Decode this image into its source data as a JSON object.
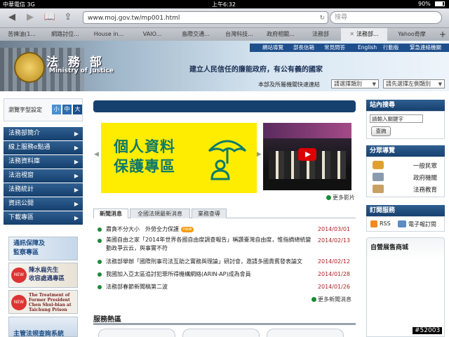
{
  "status": {
    "carrier": "中華電信 3G",
    "time": "上午6:32",
    "battery": "90%"
  },
  "browser": {
    "url": "www.moj.gov.tw/mp001.html",
    "search_placeholder": "搜尋",
    "tabs": [
      {
        "label": "苦揀油(1..."
      },
      {
        "label": "網路討位..."
      },
      {
        "label": "House in..."
      },
      {
        "label": "VAIO..."
      },
      {
        "label": "島際交通..."
      },
      {
        "label": "台灣科技..."
      },
      {
        "label": "政府相關..."
      },
      {
        "label": "法務部"
      },
      {
        "label": "法務部..."
      },
      {
        "label": "Yahoo奇摩"
      }
    ],
    "new_tab": "+"
  },
  "header": {
    "title_zh": "法 務 部",
    "title_en": "Ministry of Justice",
    "slogan": "建立人民信任的廉能政府，有公有義的國家",
    "topnav": [
      "網站導覽",
      "部長信箱",
      "常見問答",
      "English",
      "行動版",
      "緊急連絡機關"
    ],
    "quick_label": "本部及所屬機關快速連結",
    "select1": "請選擇類別",
    "select2": "請先選擇左側類別"
  },
  "left": {
    "fontsize_label": "瀏覽字型設定",
    "fontsize_buttons": [
      "小",
      "中",
      "大"
    ],
    "menu": [
      "法務部簡介",
      "線上服務e點通",
      "法務資料庫",
      "法治視窗",
      "法務統計",
      "資訊公開",
      "下載專區"
    ],
    "banners": [
      {
        "text": "通訊保障及\n監察專區"
      },
      {
        "text": "陳水扁先生\n收容處遇專區",
        "badge": "NEW"
      },
      {
        "text": "The Treatment of Former President Chen Shui-bian at Taichung Prison",
        "badge": "NEW"
      },
      {
        "text": "主管法規查詢系統"
      }
    ]
  },
  "center": {
    "privacy_line1": "個人資料",
    "privacy_line2": "保護專區",
    "more_video": "更多影片",
    "news_tabs": [
      "新聞消息",
      "全國法規最新消息",
      "業務查導"
    ],
    "news": [
      {
        "title": "肅貪不分大小　外勞全力保護",
        "date": "2014/03/01",
        "badge": "new"
      },
      {
        "title": "美國自由之家「2014年世界各國自由度調查報告」稱讚臺灣自由度，惟指摘總統變動政爭云云，與事實不符",
        "date": "2014/02/13"
      },
      {
        "title": "法務部舉辦「國際刑事司法互助之實務與理論」研討會，邀請多國貴賓發表論文",
        "date": "2014/02/12"
      },
      {
        "title": "我國加入亞太區追討犯罪所得機構網絡(ARIN-AP)成為會員",
        "date": "2014/01/28"
      },
      {
        "title": "法務部春節新聞稿第二波",
        "date": "2014/01/26"
      }
    ],
    "more_news": "更多新聞消息",
    "service_title": "服務熱區"
  },
  "right": {
    "search_title": "站內搜尋",
    "search_placeholder": "請輸入關鍵字",
    "search_button": "查詢",
    "share_title": "分眾導覽",
    "share_items": [
      "一般民眾",
      "政府機關",
      "法務教育"
    ],
    "subscribe_title": "訂閱服務",
    "rss": "RSS",
    "epaper": "電子報訂閱",
    "market_title": "自營展售商城"
  },
  "watermark": "#52003"
}
